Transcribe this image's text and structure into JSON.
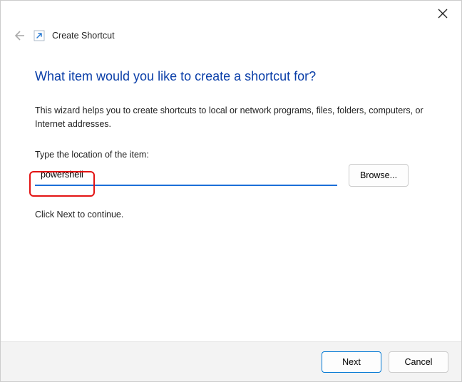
{
  "window": {
    "title": "Create Shortcut"
  },
  "content": {
    "heading": "What item would you like to create a shortcut for?",
    "description": "This wizard helps you to create shortcuts to local or network programs, files, folders, computers, or Internet addresses.",
    "location_label": "Type the location of the item:",
    "location_value": "powershell",
    "browse_label": "Browse...",
    "continue_text": "Click Next to continue."
  },
  "footer": {
    "next_label": "Next",
    "cancel_label": "Cancel"
  }
}
